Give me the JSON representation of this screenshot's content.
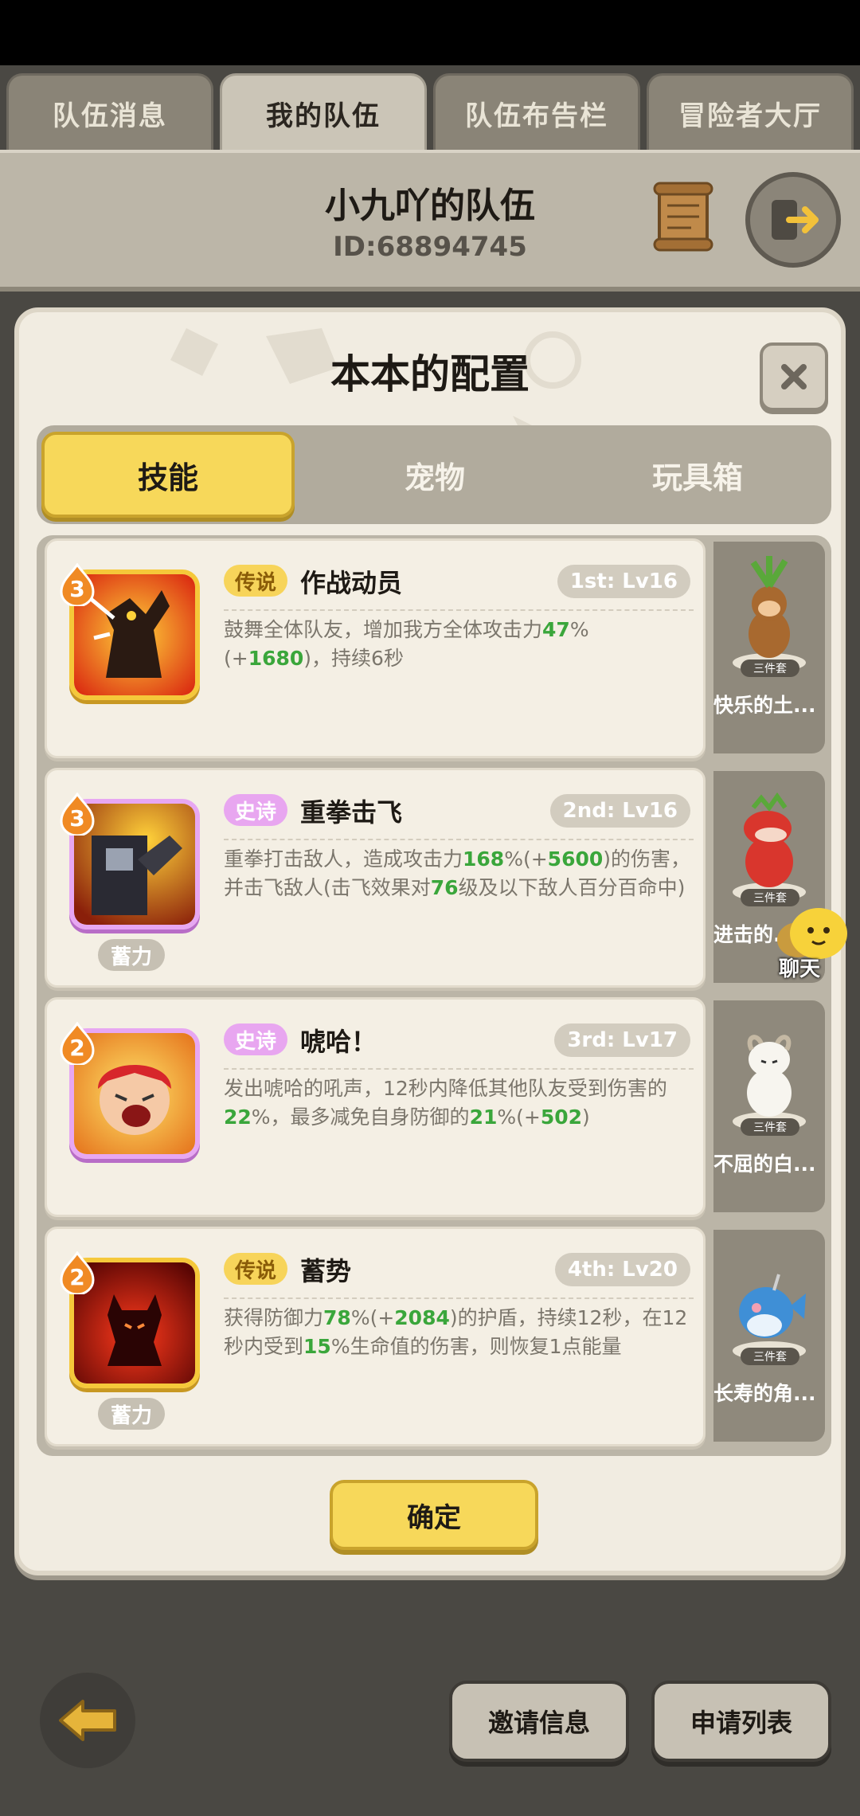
{
  "top_tabs": [
    {
      "label": "队伍消息",
      "active": false
    },
    {
      "label": "我的队伍",
      "active": true
    },
    {
      "label": "队伍布告栏",
      "active": false
    },
    {
      "label": "冒险者大厅",
      "active": false
    }
  ],
  "team": {
    "name": "小九吖的队伍",
    "id": "ID:68894745"
  },
  "modal": {
    "title": "本本的配置",
    "tabs": [
      "技能",
      "宠物",
      "玩具箱"
    ],
    "active_tab": 0,
    "skills": [
      {
        "level_badge": "3",
        "rarity": "传说",
        "rarity_type": "legend",
        "name": "作战动员",
        "slot_level": "1st: Lv16",
        "charge": "",
        "desc": [
          {
            "t": "鼓舞全体队友，增加我方全体攻击力",
            "g": false
          },
          {
            "t": "47",
            "g": true
          },
          {
            "t": "%(+",
            "g": false
          },
          {
            "t": "1680",
            "g": true
          },
          {
            "t": ")，持续6秒",
            "g": false
          }
        ],
        "pet_name": "快乐的土...",
        "pet_set": "三件套",
        "icon": "rally-skill-icon",
        "pet_icon": "monkey-pet-icon",
        "colors": {
          "bg1": "#ff9a1f",
          "bg2": "#d9230f"
        }
      },
      {
        "level_badge": "3",
        "rarity": "史诗",
        "rarity_type": "epic",
        "name": "重拳击飞",
        "slot_level": "2nd: Lv16",
        "charge": "蓄力",
        "desc": [
          {
            "t": "重拳打击敌人，造成攻击力",
            "g": false
          },
          {
            "t": "168",
            "g": true
          },
          {
            "t": "%(+",
            "g": false
          },
          {
            "t": "5600",
            "g": true
          },
          {
            "t": ")的伤害，并击飞敌人(击飞效果对",
            "g": false
          },
          {
            "t": "76",
            "g": true
          },
          {
            "t": "级及以下敌人百分百命中)",
            "g": false
          }
        ],
        "pet_name": "进击的...",
        "pet_set": "三件套",
        "icon": "heavy-punch-skill-icon",
        "pet_icon": "red-dragon-pet-icon",
        "colors": {
          "bg1": "#ffb23a",
          "bg2": "#d8420e"
        }
      },
      {
        "level_badge": "2",
        "rarity": "史诗",
        "rarity_type": "epic",
        "name": "唬哈！",
        "slot_level": "3rd: Lv17",
        "charge": "",
        "desc": [
          {
            "t": "发出唬哈的吼声，12秒内降低其他队友受到伤害的",
            "g": false
          },
          {
            "t": "22",
            "g": true
          },
          {
            "t": "%，最多减免自身防御的",
            "g": false
          },
          {
            "t": "21",
            "g": true
          },
          {
            "t": "%(+",
            "g": false
          },
          {
            "t": "502",
            "g": true
          },
          {
            "t": ")",
            "g": false
          }
        ],
        "pet_name": "不屈的白...",
        "pet_set": "三件套",
        "icon": "roar-skill-icon",
        "pet_icon": "white-goat-pet-icon",
        "colors": {
          "bg1": "#ffcc4a",
          "bg2": "#e5731c"
        }
      },
      {
        "level_badge": "2",
        "rarity": "传说",
        "rarity_type": "legend",
        "name": "蓄势",
        "slot_level": "4th: Lv20",
        "charge": "蓄力",
        "desc": [
          {
            "t": "获得防御力",
            "g": false
          },
          {
            "t": "78",
            "g": true
          },
          {
            "t": "%(+",
            "g": false
          },
          {
            "t": "2084",
            "g": true
          },
          {
            "t": ")的护盾，持续12秒，在12秒内受到",
            "g": false
          },
          {
            "t": "15",
            "g": true
          },
          {
            "t": "%生命值的伤害，则恢复1点能量",
            "g": false
          }
        ],
        "pet_name": "长寿的角...",
        "pet_set": "三件套",
        "icon": "power-up-skill-icon",
        "pet_icon": "blue-whale-pet-icon",
        "colors": {
          "bg1": "#e8331b",
          "bg2": "#6d0906"
        }
      }
    ],
    "confirm_label": "确定"
  },
  "chat_label": "聊天",
  "bottom": {
    "invite_label": "邀请信息",
    "apply_label": "申请列表"
  }
}
